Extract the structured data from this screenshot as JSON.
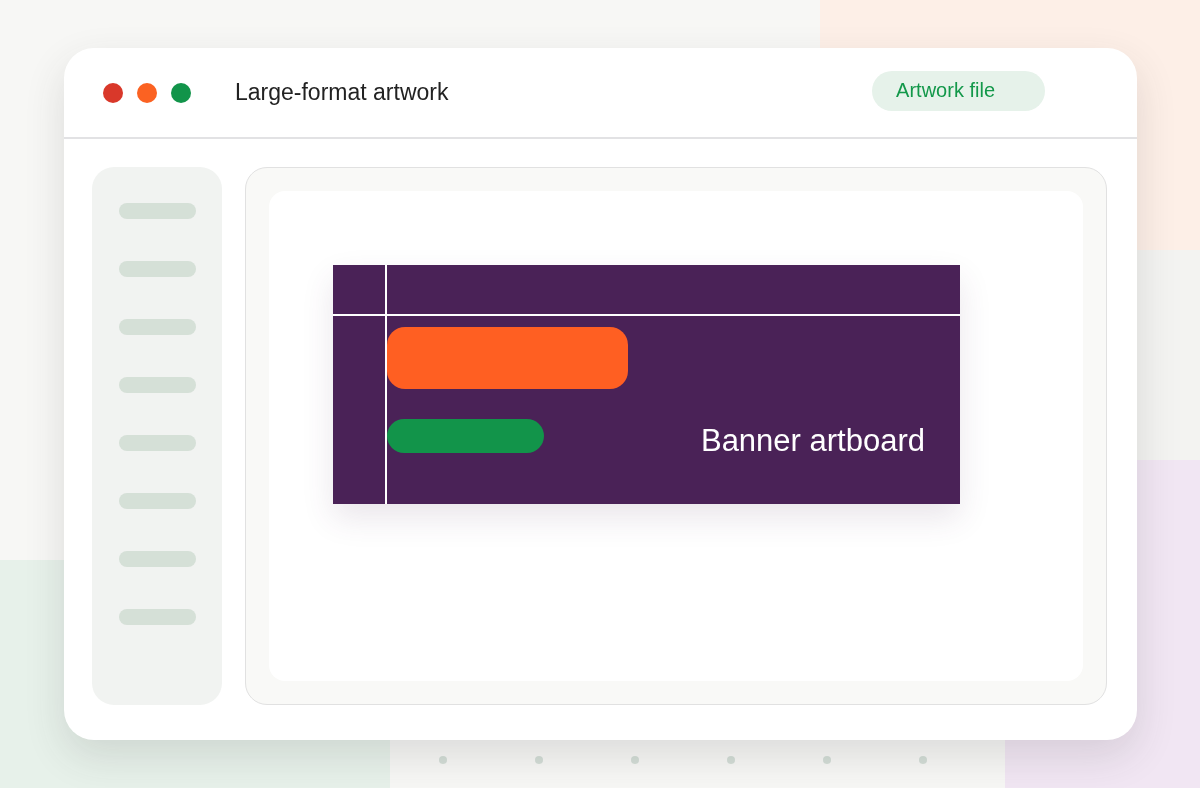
{
  "window": {
    "title": "Large-format artwork",
    "controls": [
      {
        "color": "#d9382a"
      },
      {
        "color": "#fb6222"
      },
      {
        "color": "#12944a"
      }
    ],
    "badge": "Artwork file"
  },
  "sidebar": {
    "items": [
      {
        "kind": "placeholder"
      },
      {
        "kind": "placeholder"
      },
      {
        "kind": "placeholder"
      },
      {
        "kind": "placeholder"
      },
      {
        "kind": "placeholder"
      },
      {
        "kind": "placeholder"
      },
      {
        "kind": "placeholder"
      },
      {
        "kind": "placeholder"
      }
    ]
  },
  "artboard": {
    "title": "Banner artboard",
    "shapes": [
      {
        "kind": "large",
        "color": "#ff5f22"
      },
      {
        "kind": "small",
        "color": "#12944a"
      }
    ]
  }
}
